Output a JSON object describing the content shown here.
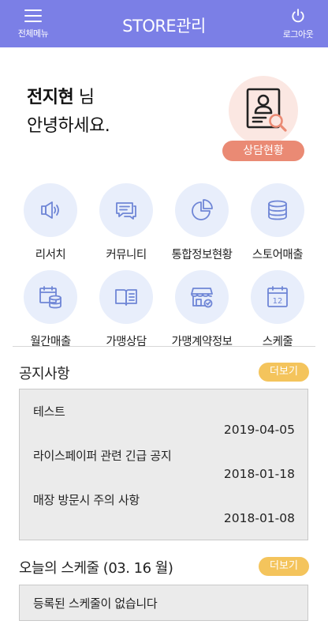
{
  "header": {
    "menu_label": "전체메뉴",
    "title": "STORE관리",
    "logout_label": "로그아웃",
    "menu_icon": "hamburger-icon",
    "logout_icon": "power-icon",
    "bg_color": "#7b7fe6"
  },
  "greeting": {
    "name": "전지현",
    "suffix": " 님",
    "message": "안녕하세요."
  },
  "consult": {
    "label": "상담현황",
    "icon": "profile-search-icon",
    "color": "#ea8a74"
  },
  "menu_grid": [
    {
      "label": "리서치",
      "icon": "megaphone-icon"
    },
    {
      "label": "커뮤니티",
      "icon": "chat-icon"
    },
    {
      "label": "통합정보현황",
      "icon": "pie-chart-icon"
    },
    {
      "label": "스토어매출",
      "icon": "database-icon"
    },
    {
      "label": "월간매출",
      "icon": "calendar-coins-icon"
    },
    {
      "label": "가맹상담",
      "icon": "book-icon"
    },
    {
      "label": "가맹계약정보",
      "icon": "store-icon"
    },
    {
      "label": "스케줄",
      "icon": "calendar-12-icon"
    }
  ],
  "notices": {
    "title": "공지사항",
    "more_label": "더보기",
    "items": [
      {
        "title": "테스트",
        "date": "2019-04-05"
      },
      {
        "title": "라이스페이퍼 관련 긴급 공지",
        "date": "2018-01-18"
      },
      {
        "title": "매장 방문시 주의 사항",
        "date": "2018-01-08"
      }
    ]
  },
  "schedule": {
    "title": "오늘의 스케줄 (03. 16 월)",
    "more_label": "더보기",
    "empty_text": "등록된 스케줄이 없습니다"
  },
  "colors": {
    "accent": "#7b7fe6",
    "more_button": "#f4c45c",
    "icon_circle": "#e8eefb",
    "icon_stroke": "#6f86d6"
  }
}
